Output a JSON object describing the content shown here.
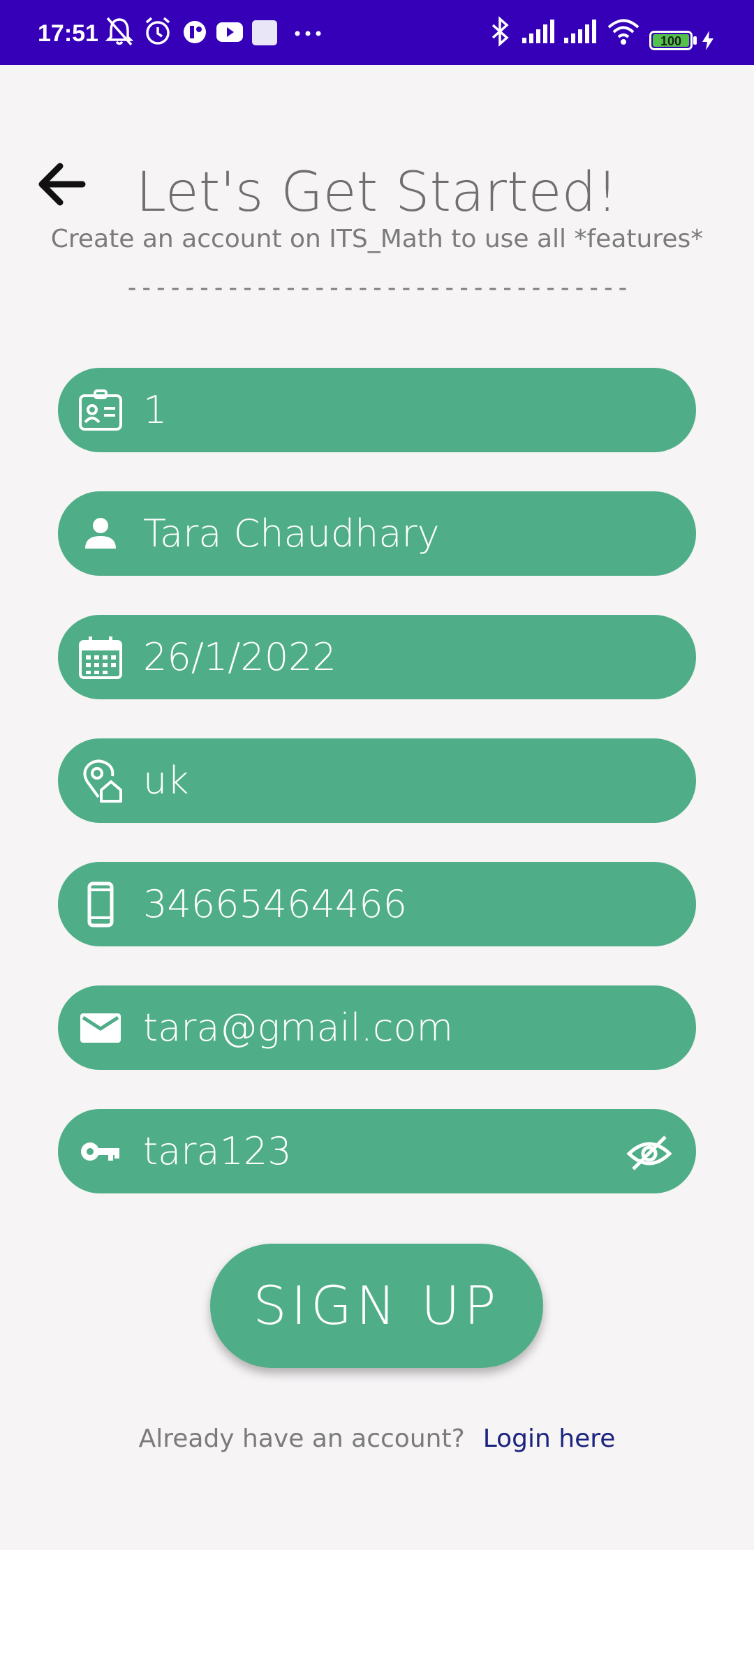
{
  "status_bar": {
    "time": "17:51",
    "battery": "100",
    "color": "#3600b8"
  },
  "header": {
    "back_icon": "arrow-left-icon",
    "title": "Let's Get Started!",
    "subtitle": "Create an account on ITS_Math to use all *features*",
    "divider": "-----------------------------------"
  },
  "form": {
    "accent_color": "#4fae87",
    "fields": [
      {
        "icon": "id-card-icon",
        "value": "1"
      },
      {
        "icon": "person-icon",
        "value": "Tara Chaudhary"
      },
      {
        "icon": "calendar-icon",
        "value": "26/1/2022"
      },
      {
        "icon": "location-home-icon",
        "value": "uk"
      },
      {
        "icon": "smartphone-icon",
        "value": "34665464466"
      },
      {
        "icon": "email-icon",
        "value": "tara@gmail.com"
      },
      {
        "icon": "key-icon",
        "value": "tara123",
        "toggle_icon": "eye-off-icon"
      }
    ],
    "submit_label": "SIGN UP"
  },
  "footer": {
    "question": "Already have an account?",
    "link_label": "Login here"
  }
}
